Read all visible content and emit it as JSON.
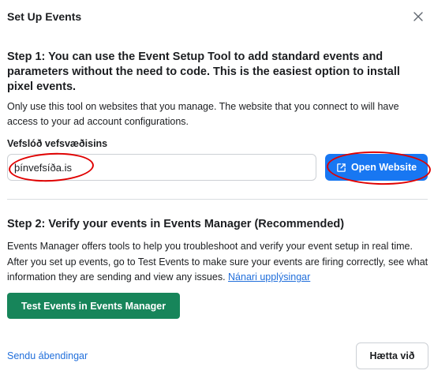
{
  "dialog": {
    "title": "Set Up Events"
  },
  "step1": {
    "heading": "Step 1: You can use the Event Setup Tool to add standard events and parameters without the need to code. This is the easiest option to install pixel events.",
    "description": "Only use this tool on websites that you manage. The website that you connect to will have access to your ad account configurations.",
    "field_label": "Vefslóð vefsvæðisins",
    "url_value": "þínvefsíða.is",
    "open_button_label": "Open Website"
  },
  "step2": {
    "heading": "Step 2: Verify your events in Events Manager (Recommended)",
    "description": "Events Manager offers tools to help you troubleshoot and verify your event setup in real time. After you set up events, go to Test Events to make sure your events are firing correctly, see what information they are sending and view any issues.",
    "learn_more_link": "Nánari upplýsingar",
    "test_button_label": "Test Events in Events Manager"
  },
  "footer": {
    "feedback_link": "Sendu ábendingar",
    "cancel_label": "Hætta við"
  },
  "icons": {
    "close": "close-icon",
    "open_external": "external-link-icon"
  },
  "colors": {
    "primary_blue": "#1877f2",
    "link_blue": "#216fdb",
    "green_button": "#17855a",
    "annotation_red": "#e00000"
  }
}
